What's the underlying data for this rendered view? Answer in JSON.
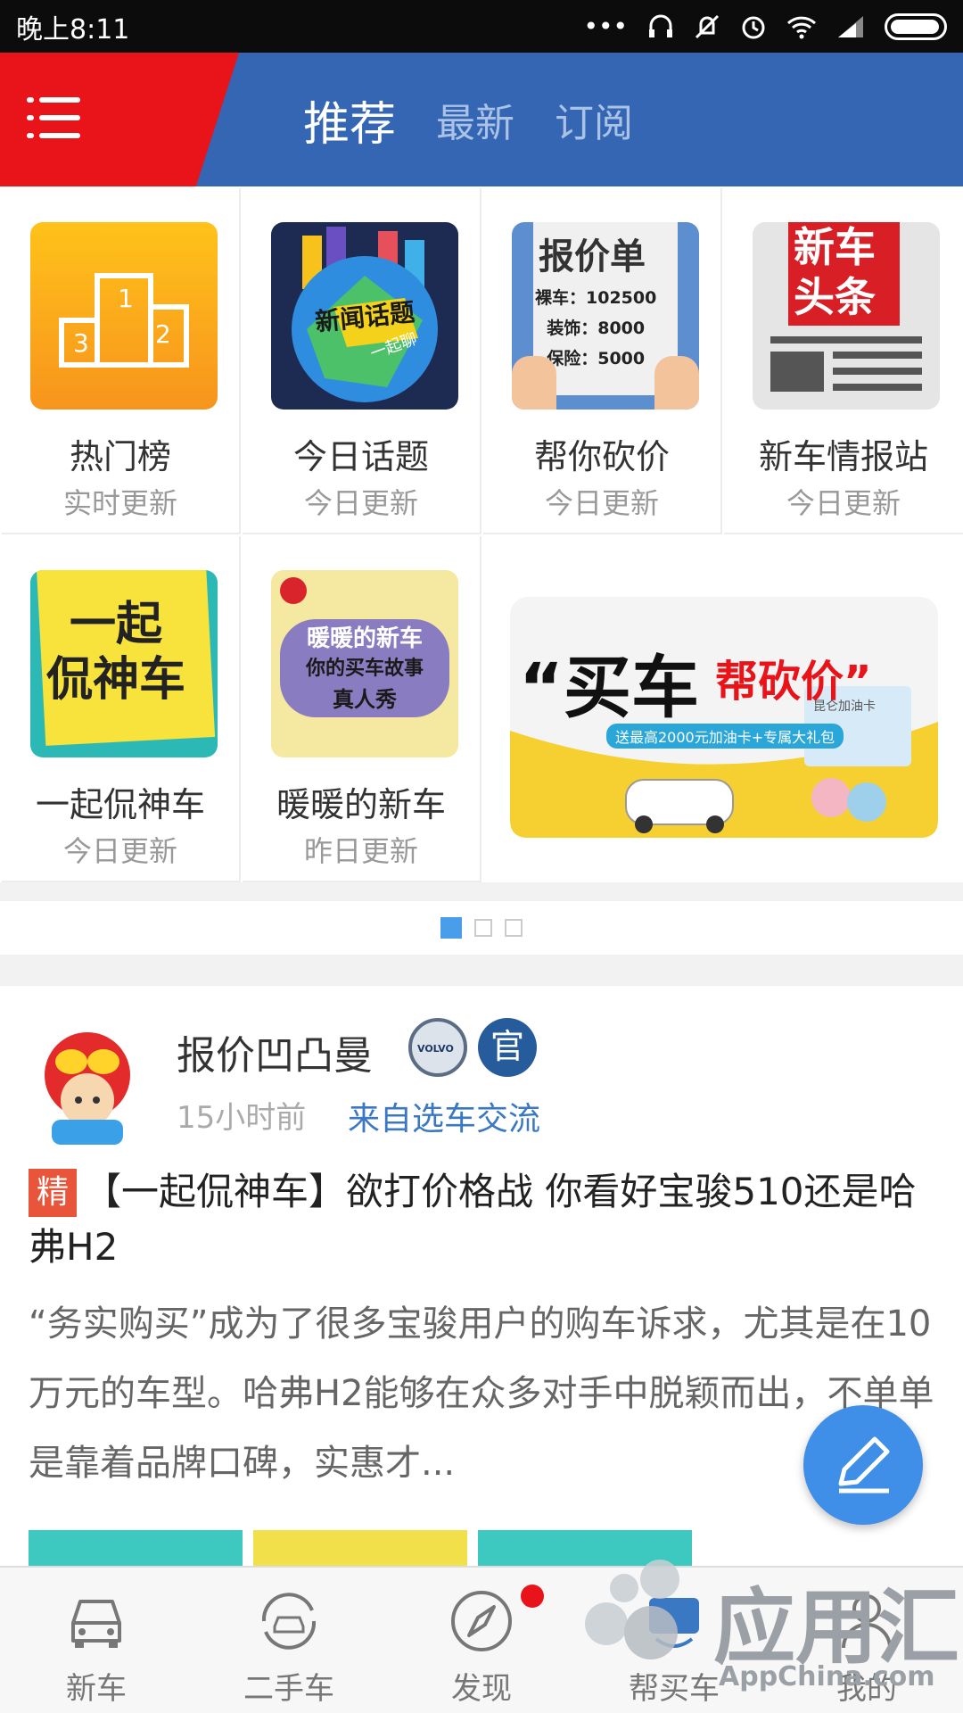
{
  "status_bar": {
    "time": "晚上8:11"
  },
  "header": {
    "tabs": [
      {
        "label": "推荐"
      },
      {
        "label": "最新"
      },
      {
        "label": "订阅"
      }
    ]
  },
  "grid": {
    "items": [
      {
        "title": "热门榜",
        "sub": "实时更新"
      },
      {
        "title": "今日话题",
        "sub": "今日更新",
        "icon_text": "新闻话题",
        "icon_text2": "一起聊"
      },
      {
        "title": "帮你砍价",
        "sub": "今日更新",
        "icon_text": "报价单",
        "lines": [
          "裸车：102500",
          "装饰：8000",
          "保险：5000"
        ]
      },
      {
        "title": "新车情报站",
        "sub": "今日更新",
        "icon_text": "新车",
        "icon_text2": "头条"
      },
      {
        "title": "一起侃神车",
        "sub": "今日更新",
        "icon_text": "一起",
        "icon_text2": "侃神车"
      },
      {
        "title": "暖暖的新车",
        "sub": "昨日更新",
        "icon_text": "暖暖的新车",
        "icon_text2": "你的买车故事",
        "icon_text3": "真人秀"
      }
    ],
    "banner": {
      "headline_a": "“买车",
      "headline_b": "帮砍价”",
      "tagline": "送最高2000元加油卡+专属大礼包",
      "card": "昆仑加油卡"
    },
    "pager": {
      "pages": 3,
      "current": 1
    }
  },
  "post": {
    "author": "报价凹凸曼",
    "volvo_badge": "VOLVO",
    "official_badge": "官",
    "time": "15小时前",
    "source": "来自选车交流",
    "tag": "精",
    "title": "【一起侃神车】欲打价格战 你看好宝骏510还是哈弗H2",
    "body": "“务实购买”成为了很多宝骏用户的购车诉求，尤其是在10万元的车型。哈弗H2能够在众多对手中脱颖而出，不单单是靠着品牌口碑，实惠才..."
  },
  "bottom_nav": {
    "items": [
      {
        "label": "新车"
      },
      {
        "label": "二手车"
      },
      {
        "label": "发现"
      },
      {
        "label": "帮买车"
      },
      {
        "label": "我的"
      }
    ]
  },
  "watermark": {
    "text": "应用汇",
    "sub": "AppChina.com"
  },
  "colors": {
    "header_blue": "#3466b3",
    "header_red": "#e8141a",
    "accent": "#3f8ee8"
  }
}
